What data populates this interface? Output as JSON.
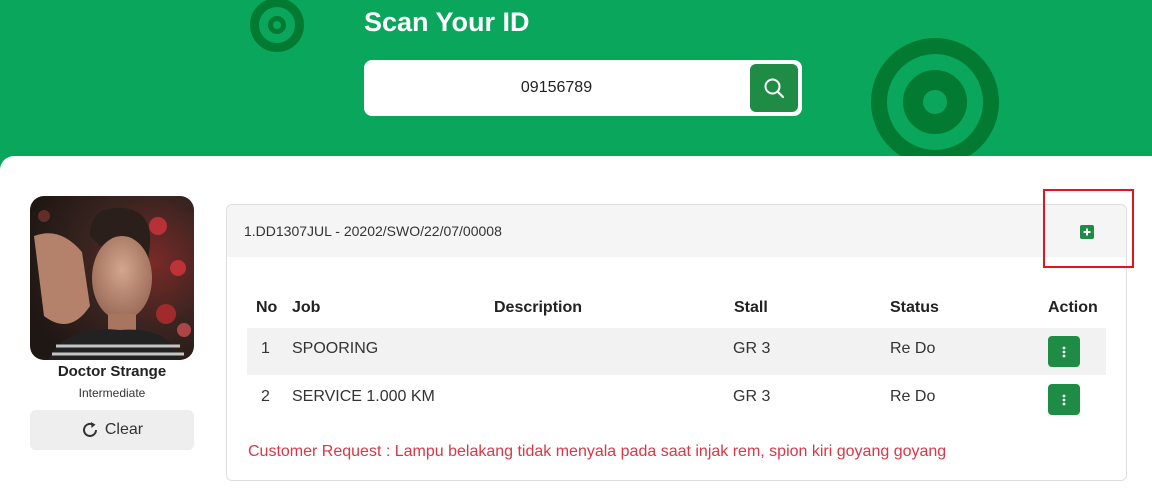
{
  "header": {
    "title": "Scan Your ID",
    "scan_value": "09156789",
    "search_icon": "search-icon"
  },
  "profile": {
    "name": "Doctor Strange",
    "level": "Intermediate",
    "clear_label": "Clear",
    "clear_icon": "refresh-icon"
  },
  "job_card": {
    "title": "1.DD1307JUL - 20202/SWO/22/07/00008",
    "add_icon": "plus-square-icon",
    "columns": [
      "No",
      "Job",
      "Description",
      "Stall",
      "Status",
      "Action"
    ],
    "rows": [
      {
        "no": "1",
        "job": "SPOORING",
        "description": "",
        "stall": "GR 3",
        "status": "Re Do"
      },
      {
        "no": "2",
        "job": "SERVICE 1.000 KM",
        "description": "",
        "stall": "GR 3",
        "status": "Re Do"
      }
    ],
    "customer_request": "Customer Request : Lampu belakang tidak menyala pada saat injak rem, spion kiri goyang goyang"
  },
  "colors": {
    "header_green": "#0aa65c",
    "button_green": "#1e8c44",
    "deco_green": "#037a31",
    "request_red": "#dc3545",
    "highlight_red": "#e3141b"
  }
}
